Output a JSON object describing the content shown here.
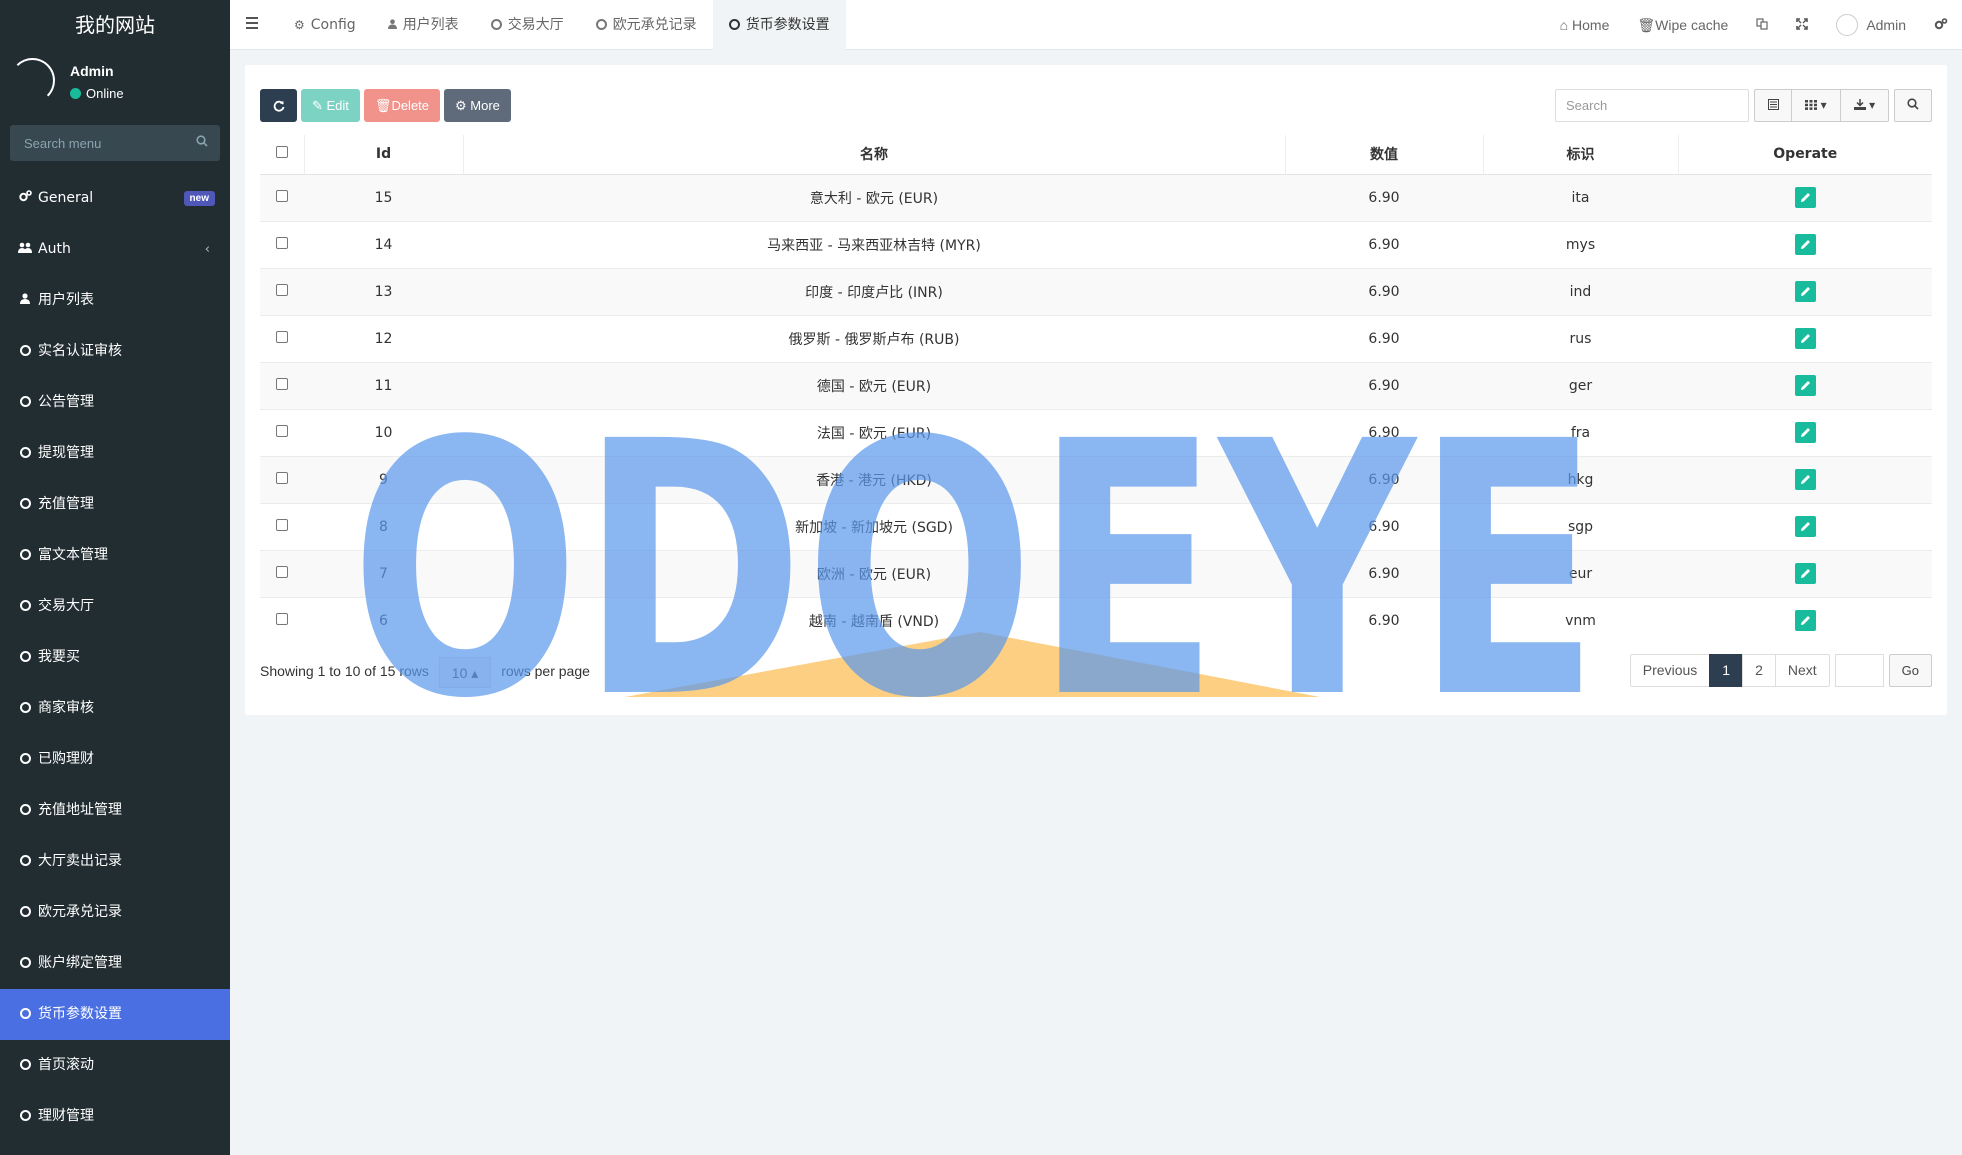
{
  "sidebar": {
    "logo": "我的网站",
    "user": {
      "name": "Admin",
      "status": "Online"
    },
    "search_placeholder": "Search menu",
    "items": [
      {
        "label": "General",
        "icon": "cogs-icon",
        "badge": "new"
      },
      {
        "label": "Auth",
        "icon": "users-icon"
      },
      {
        "label": "用户列表",
        "icon": "user-icon"
      },
      {
        "label": "实名认证审核",
        "icon": "circle-icon"
      },
      {
        "label": "公告管理",
        "icon": "circle-icon"
      },
      {
        "label": "提现管理",
        "icon": "circle-icon"
      },
      {
        "label": "充值管理",
        "icon": "circle-icon"
      },
      {
        "label": "富文本管理",
        "icon": "circle-icon"
      },
      {
        "label": "交易大厅",
        "icon": "circle-icon"
      },
      {
        "label": "我要买",
        "icon": "circle-icon"
      },
      {
        "label": "商家审核",
        "icon": "circle-icon"
      },
      {
        "label": "已购理财",
        "icon": "circle-icon"
      },
      {
        "label": "充值地址管理",
        "icon": "circle-icon"
      },
      {
        "label": "大厅卖出记录",
        "icon": "circle-icon"
      },
      {
        "label": "欧元承兑记录",
        "icon": "circle-icon"
      },
      {
        "label": "账户绑定管理",
        "icon": "circle-icon"
      },
      {
        "label": "货币参数设置",
        "icon": "circle-icon",
        "active": true
      },
      {
        "label": "首页滚动",
        "icon": "circle-icon"
      },
      {
        "label": "理财管理",
        "icon": "circle-icon"
      }
    ]
  },
  "topnav": {
    "tabs": [
      {
        "label": "Config",
        "icon": "gear-icon"
      },
      {
        "label": "用户列表",
        "icon": "user-icon"
      },
      {
        "label": "交易大厅",
        "icon": "circle-icon"
      },
      {
        "label": "欧元承兑记录",
        "icon": "circle-icon"
      },
      {
        "label": "货币参数设置",
        "icon": "circle-icon",
        "active": true
      }
    ],
    "home": "Home",
    "wipe_cache": "Wipe cache",
    "admin": "Admin"
  },
  "toolbar": {
    "edit": "Edit",
    "delete": "Delete",
    "more": "More",
    "search_placeholder": "Search"
  },
  "table": {
    "headers": [
      "Id",
      "名称",
      "数值",
      "标识",
      "Operate"
    ],
    "rows": [
      {
        "id": "15",
        "name": "意大利 - 欧元 (EUR)",
        "value": "6.90",
        "code": "ita"
      },
      {
        "id": "14",
        "name": "马来西亚 - 马来西亚林吉特 (MYR)",
        "value": "6.90",
        "code": "mys"
      },
      {
        "id": "13",
        "name": "印度 - 印度卢比 (INR)",
        "value": "6.90",
        "code": "ind"
      },
      {
        "id": "12",
        "name": "俄罗斯 - 俄罗斯卢布 (RUB)",
        "value": "6.90",
        "code": "rus"
      },
      {
        "id": "11",
        "name": "德国 - 欧元 (EUR)",
        "value": "6.90",
        "code": "ger"
      },
      {
        "id": "10",
        "name": "法国 - 欧元 (EUR)",
        "value": "6.90",
        "code": "fra"
      },
      {
        "id": "9",
        "name": "香港 - 港元 (HKD)",
        "value": "6.90",
        "code": "hkg"
      },
      {
        "id": "8",
        "name": "新加坡 - 新加坡元 (SGD)",
        "value": "6.90",
        "code": "sgp"
      },
      {
        "id": "7",
        "name": "欧洲 - 欧元 (EUR)",
        "value": "6.90",
        "code": "eur"
      },
      {
        "id": "6",
        "name": "越南 - 越南盾 (VND)",
        "value": "6.90",
        "code": "vnm"
      }
    ]
  },
  "pagination": {
    "showing_prefix": "Showing 1 to 10 of",
    "total": "15 rows",
    "page_size": "10",
    "rows_per_page": "rows per page",
    "previous": "Previous",
    "pages": [
      "1",
      "2"
    ],
    "next": "Next",
    "go": "Go"
  },
  "watermark": "ODOEYE"
}
